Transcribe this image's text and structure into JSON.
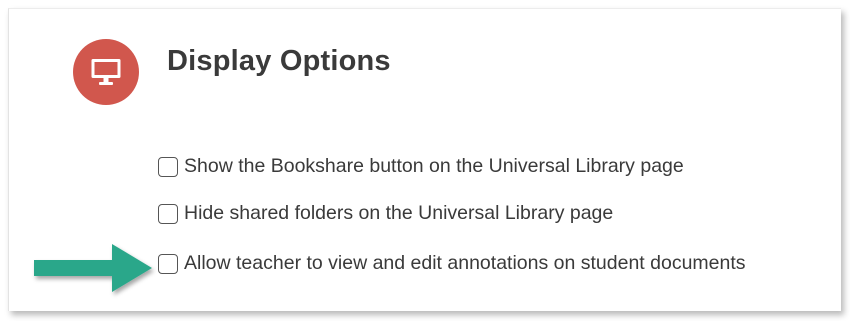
{
  "section": {
    "title": "Display Options",
    "icon": "monitor-icon",
    "icon_bg_color": "#d1574d"
  },
  "options": [
    {
      "label": "Show the Bookshare button on the Universal Library page",
      "checked": false
    },
    {
      "label": "Hide shared folders on the Universal Library page",
      "checked": false
    },
    {
      "label": "Allow teacher to view and edit annotations on student documents",
      "checked": false
    }
  ],
  "annotation": {
    "icon": "arrow-right-icon",
    "color": "#2aa78a"
  }
}
